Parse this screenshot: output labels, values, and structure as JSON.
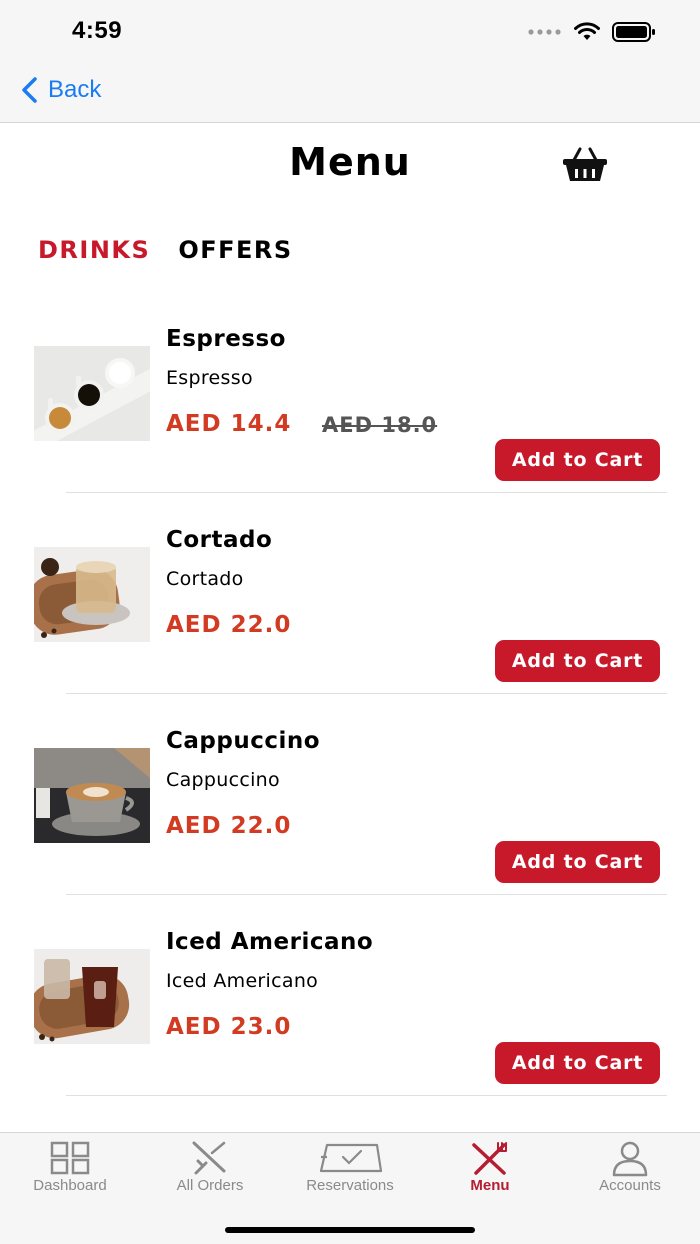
{
  "status_bar": {
    "time": "4:59",
    "icons": [
      "signal-dots-icon",
      "wifi-icon",
      "battery-icon"
    ]
  },
  "nav": {
    "back_label": "Back"
  },
  "header": {
    "title": "Menu",
    "cart_icon": "basket-icon"
  },
  "tabs": [
    {
      "label": "DRINKS",
      "active": true
    },
    {
      "label": "OFFERS",
      "active": false
    }
  ],
  "items": [
    {
      "name": "Espresso",
      "description": "Espresso",
      "price": "AED 14.4",
      "old_price": "AED 18.0",
      "button": "Add to Cart",
      "image": "espresso-cups-photo"
    },
    {
      "name": "Cortado",
      "description": "Cortado",
      "price": "AED 22.0",
      "old_price": "",
      "button": "Add to Cart",
      "image": "cortado-photo"
    },
    {
      "name": "Cappuccino",
      "description": "Cappuccino",
      "price": "AED 22.0",
      "old_price": "",
      "button": "Add to Cart",
      "image": "cappuccino-photo"
    },
    {
      "name": "Iced Americano",
      "description": "Iced Americano",
      "price": "AED 23.0",
      "old_price": "",
      "button": "Add to Cart",
      "image": "iced-americano-photo"
    }
  ],
  "tab_bar": [
    {
      "label": "Dashboard",
      "icon": "grid-icon",
      "active": false
    },
    {
      "label": "All Orders",
      "icon": "utensils-crossed-icon",
      "active": false
    },
    {
      "label": "Reservations",
      "icon": "ticket-check-icon",
      "active": false
    },
    {
      "label": "Menu",
      "icon": "fork-knife-icon",
      "active": true
    },
    {
      "label": "Accounts",
      "icon": "person-icon",
      "active": false
    }
  ],
  "colors": {
    "accent": "#c8192b",
    "price": "#d23b22",
    "ios_blue": "#1a7cf5",
    "tab_active": "#b51d33"
  }
}
